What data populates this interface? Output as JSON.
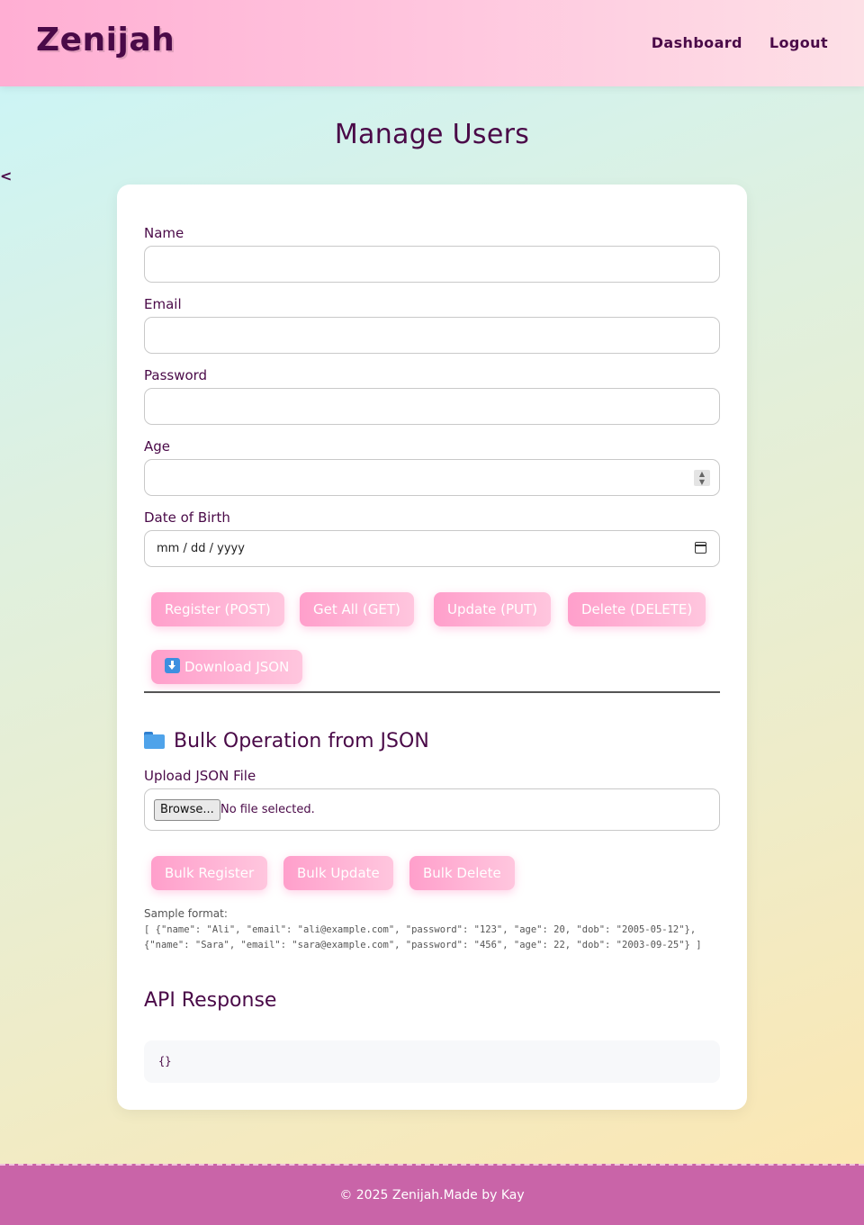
{
  "header": {
    "brand": "Zenijah",
    "nav": [
      "Dashboard",
      "Logout"
    ]
  },
  "back_link": "<",
  "page_title": "Manage Users",
  "form": {
    "name_label": "Name",
    "name_value": "",
    "email_label": "Email",
    "email_value": "",
    "password_label": "Password",
    "password_value": "",
    "age_label": "Age",
    "age_value": "",
    "dob_label": "Date of Birth",
    "dob_placeholder": "mm / dd / yyyy"
  },
  "actions": {
    "register": "Register (POST)",
    "get_all": "Get All (GET)",
    "update": "Update (PUT)",
    "delete": "Delete (DELETE)",
    "download": "Download JSON"
  },
  "bulk": {
    "title": "Bulk Operation from JSON",
    "upload_label": "Upload JSON File",
    "browse": "Browse...",
    "file_status": "No file selected.",
    "register": "Bulk Register",
    "update": "Bulk Update",
    "delete": "Bulk Delete",
    "sample_label": "Sample format:",
    "sample_line1": "[ {\"name\": \"Ali\", \"email\": \"ali@example.com\", \"password\": \"123\", \"age\": 20, \"dob\": \"2005-05-12\"},",
    "sample_line2": "{\"name\": \"Sara\", \"email\": \"sara@example.com\", \"password\": \"456\", \"age\": 22, \"dob\": \"2003-09-25\"} ]"
  },
  "response": {
    "title": "API Response",
    "body": "{}"
  },
  "footer": {
    "text": "© 2025 Zenijah.Made by Kay"
  },
  "colors": {
    "text": "#4a0a48",
    "button_gradient_start": "#ff9fcb",
    "button_gradient_end": "#ffc6de",
    "footer_bg": "#c964a8"
  },
  "icons": [
    "download-icon",
    "folder-icon",
    "calendar-icon",
    "spinner-arrows-icon"
  ]
}
